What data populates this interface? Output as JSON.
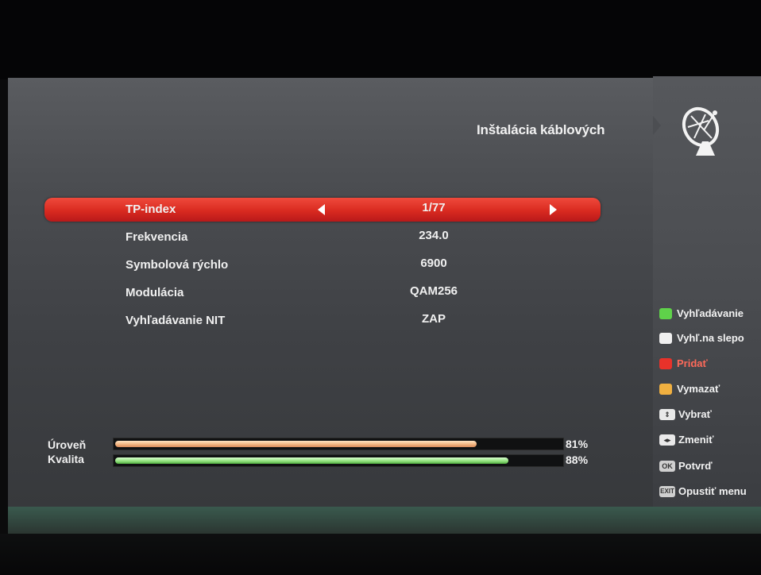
{
  "title": "Inštalácia káblových",
  "menu": [
    {
      "label": "TP-index",
      "value": "1/77",
      "selected": true
    },
    {
      "label": "Frekvencia",
      "value": "234.0"
    },
    {
      "label": "Symbolová rýchlo",
      "value": "6900"
    },
    {
      "label": "Modulácia",
      "value": "QAM256"
    },
    {
      "label": "Vyhľadávanie NIT",
      "value": "ZAP"
    }
  ],
  "signal": {
    "level": {
      "label": "Úroveň",
      "percent_text": "81%",
      "value": 0.81,
      "color": "#f2b27d"
    },
    "quality": {
      "label": "Kvalita",
      "percent_text": "88%",
      "value": 0.88,
      "color": "#8fe07a"
    }
  },
  "legend": [
    {
      "icon": "green-key",
      "color": "#5fd24a",
      "label": "Vyhľadávanie"
    },
    {
      "icon": "white-key",
      "color": "#f0f0f0",
      "label": "Vyhľ.na slepo"
    },
    {
      "icon": "red-key",
      "color": "#e8322a",
      "label": "Pridať"
    },
    {
      "icon": "yellow-key",
      "color": "#f0b040",
      "label": "Vymazať"
    },
    {
      "icon": "up-down-key",
      "key_text": "⇕",
      "label": "Vybrať"
    },
    {
      "icon": "left-right-key",
      "key_text": "◂▸",
      "label": "Zmeniť"
    },
    {
      "icon": "ok-key",
      "key_text": "OK",
      "label": "Potvrď"
    },
    {
      "icon": "exit-key",
      "key_text": "EXIT",
      "label": "Opustiť menu"
    }
  ],
  "icons": {
    "header": "satellite-dish-icon"
  }
}
